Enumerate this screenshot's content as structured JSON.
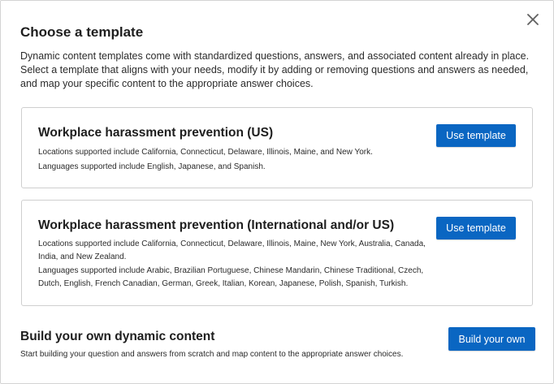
{
  "modal": {
    "title": "Choose a template",
    "intro": "Dynamic content templates come with standardized questions, answers, and associated content already in place. Select a template that aligns with your needs, modify it by adding or removing questions and answers as needed, and map your specific content to the appropriate answer choices.",
    "close_icon": "close-icon"
  },
  "templates": [
    {
      "title": "Workplace harassment prevention (US)",
      "locations": "Locations supported include California, Connecticut, Delaware, Illinois, Maine, and New York.",
      "languages": "Languages supported include English, Japanese, and Spanish.",
      "button_label": "Use template"
    },
    {
      "title": "Workplace harassment prevention (International and/or US)",
      "locations": "Locations supported include California, Connecticut, Delaware, Illinois, Maine, New York, Australia, Canada, India, and New Zealand.",
      "languages": "Languages supported include Arabic, Brazilian Portuguese, Chinese Mandarin, Chinese Traditional, Czech, Dutch, English, French Canadian, German, Greek, Italian, Korean, Japanese, Polish, Spanish, Turkish.",
      "button_label": "Use template"
    }
  ],
  "build_own": {
    "title": "Build your own dynamic content",
    "description": "Start building your question and answers from scratch and map content to the appropriate answer choices.",
    "button_label": "Build your own"
  },
  "colors": {
    "primary_button": "#0a66c2",
    "border": "#cfcfcf"
  }
}
